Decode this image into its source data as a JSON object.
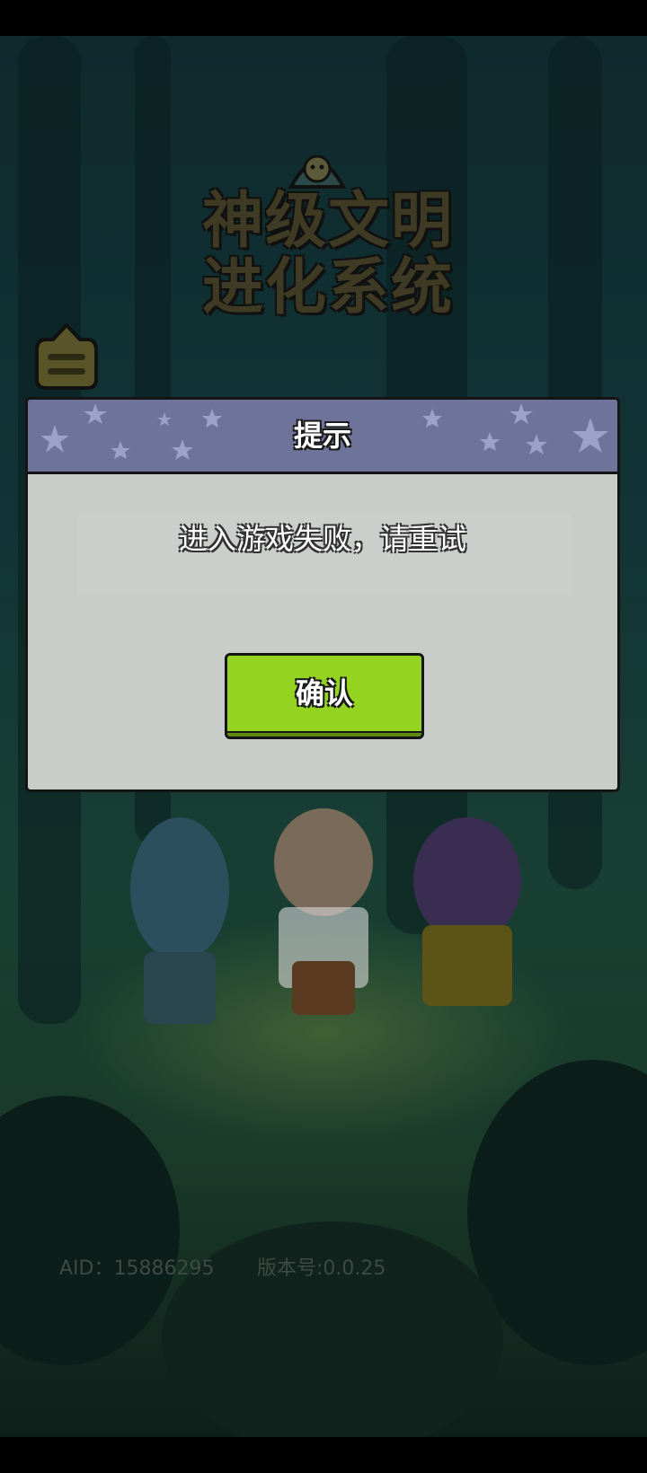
{
  "game": {
    "logo_line1": "神级文明",
    "logo_line2": "进化系统"
  },
  "dialog": {
    "title": "提示",
    "message": "进入游戏失败，请重试",
    "confirm_label": "确认"
  },
  "footer": {
    "aid": "AID：15886295",
    "version": "版本号:0.0.25"
  },
  "icons": {
    "menu": "menu-icon",
    "mascot": "alien-mascot-icon",
    "stars": "star-icon"
  },
  "colors": {
    "dialog_header": "#6e739a",
    "dialog_body": "#c9cdca",
    "confirm_button": "#94d31f",
    "background": "#123436"
  }
}
